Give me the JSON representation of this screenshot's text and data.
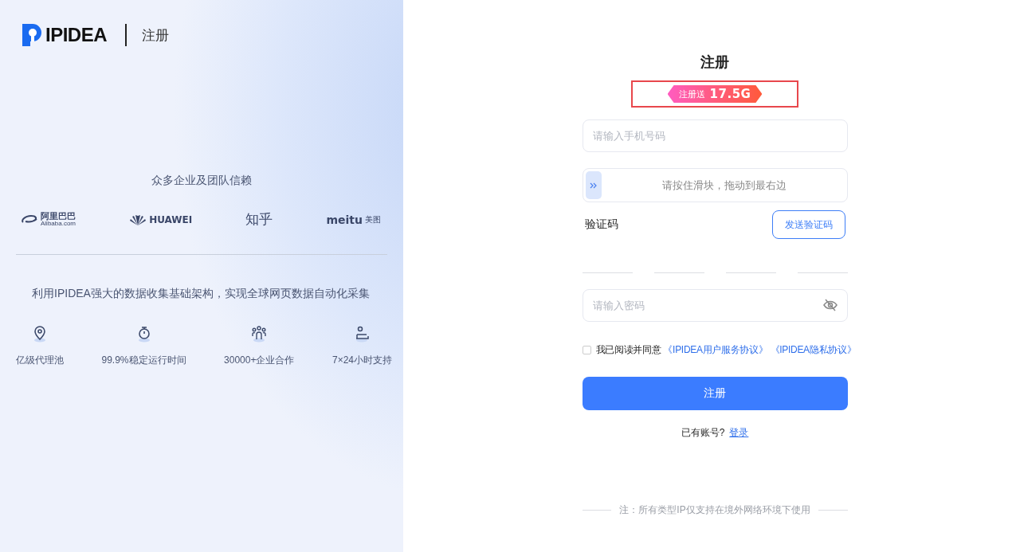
{
  "brand": {
    "name": "IPIDEA",
    "page": "注册"
  },
  "trust": {
    "title": "众多企业及团队信赖",
    "logos": [
      {
        "kind": "alibaba",
        "text": "阿里巴巴",
        "sub": "Alibaba.com"
      },
      {
        "kind": "huawei",
        "text": "HUAWEI"
      },
      {
        "kind": "zhihu",
        "text": "知乎"
      },
      {
        "kind": "meitu",
        "text": "meitu",
        "sub": "美图"
      }
    ]
  },
  "tagline": "利用IPIDEA强大的数据收集基础架构，实现全球网页数据自动化采集",
  "features": [
    {
      "kind": "pin",
      "label": "亿级代理池"
    },
    {
      "kind": "timer",
      "label": "99.9%稳定运行时间"
    },
    {
      "kind": "team",
      "label": "30000+企业合作"
    },
    {
      "kind": "support",
      "label": "7×24小时支持"
    }
  ],
  "form": {
    "title": "注册",
    "promo": {
      "label": "注册送",
      "amount": "17.5G",
      "highlighted": true
    },
    "phone": {
      "placeholder": "请输入手机号码"
    },
    "slider": {
      "hint": "请按住滑块，拖动到最右边",
      "level": 0
    },
    "code": {
      "label": "验证码",
      "button": "发送验证码",
      "inputs": [
        {
          "kind": "digit"
        },
        {
          "kind": "digit"
        },
        {
          "kind": "digit"
        },
        {
          "kind": "digit"
        }
      ]
    },
    "password": {
      "placeholder": "请输入密码",
      "visible": false
    },
    "agree": {
      "checked": false,
      "text": "我已阅读并同意",
      "links": [
        "《IPIDEA用户服务协议》",
        "《IPIDEA隐私协议》"
      ]
    },
    "submit": "注册",
    "login": {
      "text": "已有账号?",
      "link": "登录"
    },
    "note": "注：所有类型IP仅支持在境外网络环境下使用"
  }
}
